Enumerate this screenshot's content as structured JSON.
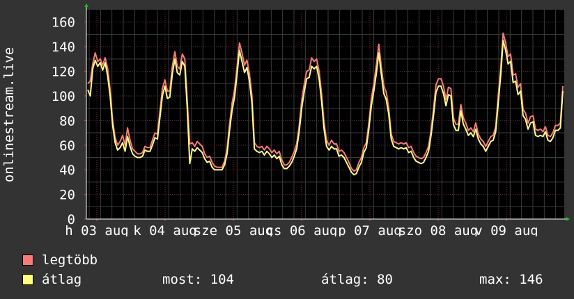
{
  "chart_data": {
    "type": "line",
    "ylabel": "onlinestream.live",
    "ylim": [
      0,
      170
    ],
    "yticks": [
      0,
      20,
      40,
      60,
      80,
      100,
      120,
      140,
      160
    ],
    "xtick_labels": [
      "h 03 aug",
      "k 04 aug",
      "sze 05 aug",
      "cs 06 aug",
      "p 07 aug",
      "szo 08 aug",
      "v 09 aug"
    ],
    "grid": true,
    "series": [
      {
        "name": "legtöbb",
        "color": "#ff7777",
        "y": [
          110,
          112,
          126,
          135,
          128,
          130,
          125,
          131,
          122,
          105,
          80,
          66,
          60,
          63,
          68,
          60,
          74,
          64,
          57,
          55,
          53,
          53,
          54,
          59,
          58,
          58,
          64,
          70,
          69,
          87,
          106,
          113,
          104,
          104,
          124,
          136,
          124,
          122,
          134,
          130,
          96,
          61,
          62,
          59,
          63,
          61,
          59,
          53,
          50,
          51,
          46,
          43,
          42,
          42,
          42,
          47,
          57,
          77,
          94,
          105,
          123,
          143,
          135,
          125,
          129,
          118,
          100,
          62,
          59,
          58,
          59,
          56,
          59,
          57,
          54,
          56,
          53,
          55,
          48,
          44,
          44,
          46,
          50,
          55,
          61,
          76,
          96,
          109,
          120,
          121,
          131,
          128,
          130,
          120,
          102,
          78,
          64,
          60,
          64,
          61,
          61,
          55,
          56,
          54,
          50,
          46,
          41,
          39,
          40,
          46,
          50,
          58,
          62,
          78,
          98,
          110,
          125,
          142,
          124,
          108,
          103,
          90,
          69,
          63,
          62,
          61,
          62,
          61,
          62,
          58,
          59,
          54,
          51,
          50,
          49,
          50,
          54,
          59,
          72,
          89,
          109,
          114,
          114,
          108,
          97,
          107,
          106,
          82,
          77,
          77,
          93,
          82,
          78,
          72,
          74,
          71,
          78,
          69,
          65,
          63,
          59,
          63,
          67,
          68,
          75,
          100,
          122,
          151,
          143,
          132,
          134,
          117,
          118,
          107,
          110,
          89,
          86,
          78,
          83,
          84,
          73,
          72,
          73,
          71,
          75,
          68,
          67,
          70,
          76,
          76,
          78,
          108
        ]
      },
      {
        "name": "átlag",
        "color": "#ffff77",
        "y": [
          105,
          100,
          122,
          129,
          124,
          127,
          121,
          127,
          116,
          100,
          76,
          62,
          56,
          58,
          62,
          55,
          67,
          59,
          53,
          51,
          50,
          50,
          51,
          56,
          55,
          55,
          60,
          66,
          65,
          82,
          100,
          108,
          98,
          99,
          118,
          130,
          119,
          117,
          128,
          124,
          90,
          45,
          57,
          55,
          58,
          56,
          54,
          49,
          46,
          47,
          42,
          40,
          40,
          40,
          40,
          44,
          53,
          72,
          88,
          99,
          117,
          137,
          128,
          119,
          123,
          112,
          94,
          57,
          55,
          54,
          55,
          52,
          55,
          53,
          50,
          52,
          49,
          51,
          44,
          41,
          41,
          43,
          46,
          51,
          57,
          71,
          90,
          103,
          114,
          115,
          124,
          122,
          124,
          114,
          96,
          73,
          59,
          56,
          59,
          57,
          57,
          51,
          52,
          50,
          46,
          42,
          38,
          36,
          37,
          42,
          46,
          54,
          58,
          73,
          92,
          104,
          118,
          135,
          118,
          102,
          97,
          85,
          65,
          59,
          58,
          57,
          58,
          57,
          58,
          54,
          55,
          50,
          47,
          46,
          45,
          46,
          50,
          55,
          68,
          84,
          103,
          108,
          108,
          102,
          92,
          101,
          100,
          77,
          72,
          72,
          88,
          77,
          73,
          68,
          70,
          67,
          73,
          65,
          61,
          59,
          55,
          59,
          63,
          64,
          71,
          94,
          116,
          145,
          137,
          126,
          128,
          111,
          112,
          101,
          104,
          84,
          81,
          73,
          78,
          79,
          68,
          67,
          68,
          67,
          71,
          64,
          63,
          66,
          72,
          72,
          74,
          104
        ]
      }
    ]
  },
  "legend": {
    "items": [
      {
        "label": "legtöbb",
        "color": "#ff7777"
      },
      {
        "label": "átlag",
        "color": "#ffff77"
      }
    ]
  },
  "stats": {
    "most": "most: 104",
    "atlag": "átlag: 80",
    "max": "max: 146"
  }
}
